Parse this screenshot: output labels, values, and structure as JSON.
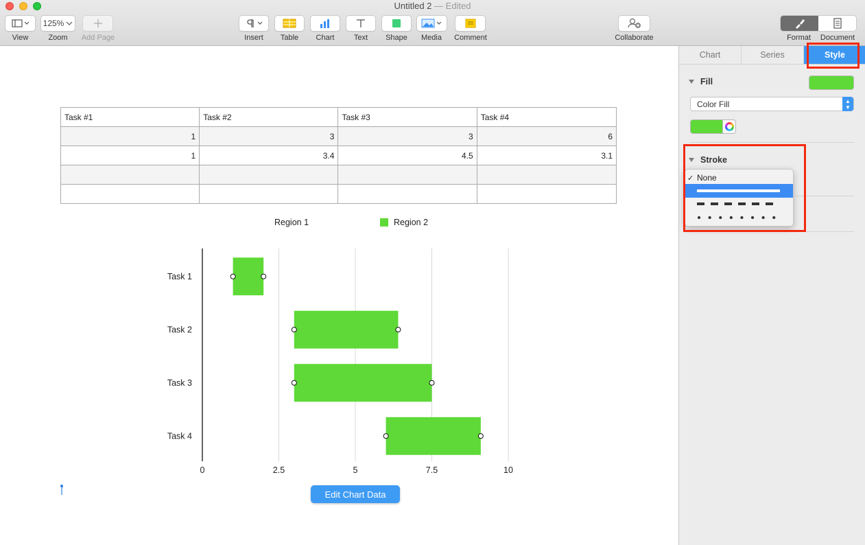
{
  "window": {
    "title": "Untitled 2",
    "status": "— Edited"
  },
  "toolbar": {
    "view_label": "View",
    "zoom_value": "125%",
    "zoom_label": "Zoom",
    "add_page_label": "Add Page",
    "insert_label": "Insert",
    "table_label": "Table",
    "chart_label": "Chart",
    "text_label": "Text",
    "shape_label": "Shape",
    "media_label": "Media",
    "comment_label": "Comment",
    "collaborate_label": "Collaborate",
    "format_label": "Format",
    "document_label": "Document"
  },
  "table": {
    "headers": [
      "Task #1",
      "Task #2",
      "Task #3",
      "Task #4"
    ],
    "rows": [
      [
        "1",
        "3",
        "3",
        "6"
      ],
      [
        "1",
        "3.4",
        "4.5",
        "3.1"
      ],
      [
        "",
        "",
        "",
        ""
      ],
      [
        "",
        "",
        "",
        ""
      ]
    ]
  },
  "chart_data": {
    "type": "bar",
    "orientation": "horizontal",
    "stacked": true,
    "categories": [
      "Task 1",
      "Task 2",
      "Task 3",
      "Task 4"
    ],
    "series": [
      {
        "name": "Region 1",
        "values": [
          1,
          3,
          3,
          6
        ],
        "color": "none"
      },
      {
        "name": "Region 2",
        "values": [
          1,
          3.4,
          4.5,
          3.1
        ],
        "color": "#5ed937"
      }
    ],
    "x_ticks": [
      "0",
      "2.5",
      "5",
      "7.5",
      "10"
    ],
    "xlim": [
      0,
      10
    ],
    "grid": "vertical",
    "legend_position": "top"
  },
  "edit_chart_button": "Edit Chart Data",
  "inspector": {
    "tabs": [
      "Chart",
      "Series",
      "Style"
    ],
    "selected_tab": "Style",
    "fill_title": "Fill",
    "fill_type": "Color Fill",
    "fill_color": "#5ed937",
    "stroke_title": "Stroke",
    "stroke_menu": {
      "none_label": "None",
      "checked": "None",
      "options": [
        "none",
        "solid",
        "dashed",
        "dotted"
      ],
      "highlighted": "solid"
    }
  },
  "colors": {
    "accent": "#3c97f3",
    "highlight_box": "#f22a0f",
    "series_fill": "#5ed937"
  }
}
